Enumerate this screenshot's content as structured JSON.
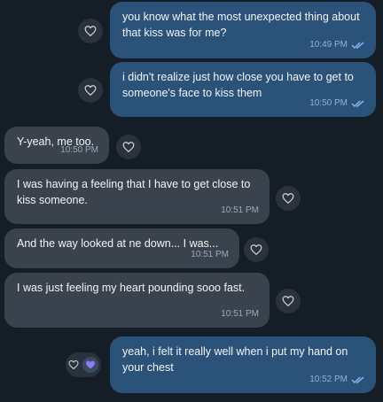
{
  "messages": [
    {
      "direction": "out",
      "text": "you know what the most unexpected thing about that kiss was for me?",
      "time": "10:49 PM",
      "read": true
    },
    {
      "direction": "out",
      "text": "i didn't realize just how close you have to get to someone's face to kiss them",
      "time": "10:50 PM",
      "read": true
    },
    {
      "direction": "in",
      "text": "Y-yeah, me too.",
      "time": "10:50 PM"
    },
    {
      "direction": "in",
      "text": "I was having a feeling that I have to get close to kiss someone.",
      "time": "10:51 PM"
    },
    {
      "direction": "in",
      "text": "And the way looked at ne down... I was...",
      "time": "10:51 PM"
    },
    {
      "direction": "in",
      "text": "I was just feeling my heart pounding sooo fast.",
      "time": "10:51 PM"
    },
    {
      "direction": "out",
      "text": "yeah, i felt it really well when i put my hand on your chest",
      "time": "10:52 PM",
      "read": true,
      "reaction": "purple-heart"
    }
  ],
  "colors": {
    "background": "#151e27",
    "outgoing_bubble": "#2b5278",
    "incoming_bubble": "#3a424d",
    "read_check": "#8db3f0",
    "reaction_heart": "#8b7cf6"
  },
  "icons": {
    "reaction_button": "heart-outline-icon",
    "read_receipt": "double-check-icon",
    "active_reaction": "purple-heart-icon"
  }
}
